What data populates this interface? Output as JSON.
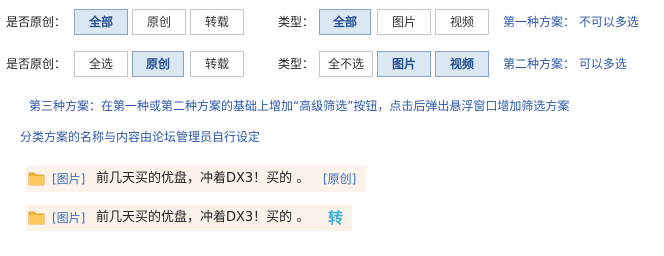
{
  "row1": {
    "original_label": "是否原创：",
    "original_buttons": [
      "全部",
      "原创",
      "转载"
    ],
    "type_label": "类型：",
    "type_buttons": [
      "全部",
      "图片",
      "视频"
    ],
    "note": "第一种方案： 不可以多选"
  },
  "row2": {
    "original_label": "是否原创：",
    "original_buttons": [
      "全选",
      "原创",
      "转载"
    ],
    "type_label": "类型：",
    "type_buttons": [
      "全不选",
      "图片",
      "视频"
    ],
    "note": "第二种方案： 可以多选"
  },
  "descriptions": [
    "第三种方案：在第一种或第二种方案的基础上增加“高级筛选”按钮，点击后弹出悬浮窗口增加筛选方案",
    "分类方案的名称与内容由论坛管理员自行设定"
  ],
  "posts": [
    {
      "category": "[图片]",
      "title": "前几天买的优盘，冲着DX3！买的 。",
      "tag": "[原创]",
      "icon": "folder-icon"
    },
    {
      "category": "[图片]",
      "title": "前几天买的优盘，冲着DX3！买的 。",
      "tag": "转",
      "icon": "folder-icon"
    }
  ],
  "colors": {
    "selected_bg": "#dbe7f3",
    "selected_text": "#25508e",
    "note_text": "#2d58a8",
    "post_bg": "#fbf2ea",
    "folder": "#f5b43c"
  }
}
